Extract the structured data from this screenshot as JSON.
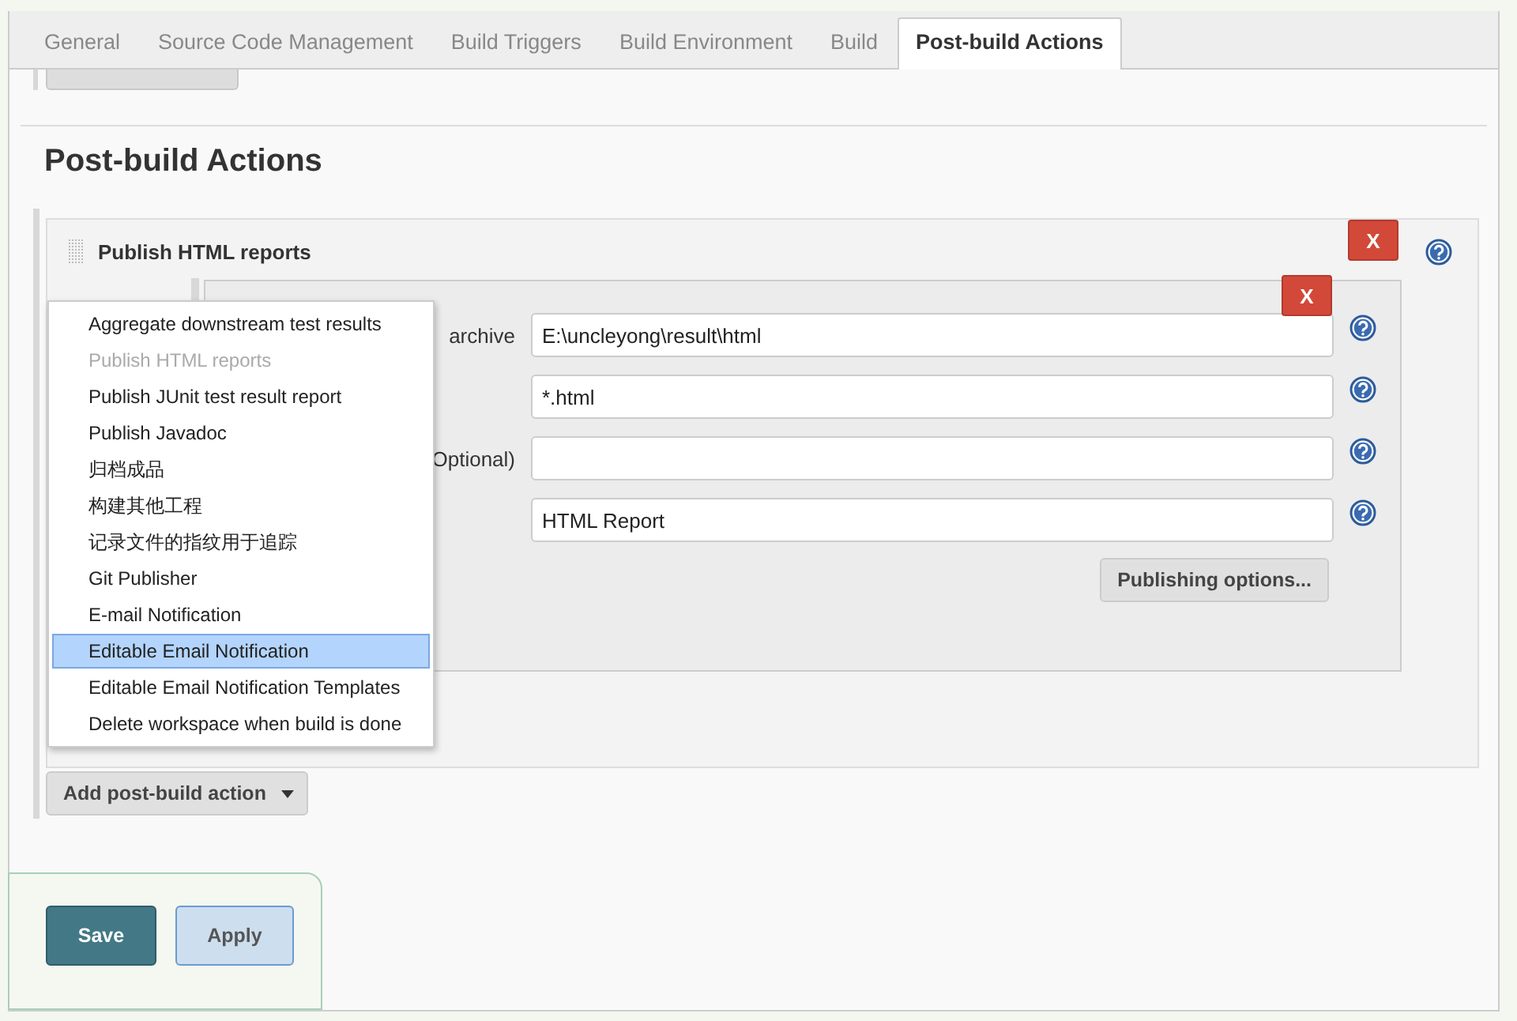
{
  "tabs": [
    {
      "label": "General",
      "selected": false
    },
    {
      "label": "Source Code Management",
      "selected": false
    },
    {
      "label": "Build Triggers",
      "selected": false
    },
    {
      "label": "Build Environment",
      "selected": false
    },
    {
      "label": "Build",
      "selected": false
    },
    {
      "label": "Post-build Actions",
      "selected": true
    }
  ],
  "section_heading": "Post-build Actions",
  "publisher": {
    "title": "Publish HTML reports",
    "delete_button": "X",
    "report": {
      "delete_button": "X",
      "fields": [
        {
          "label": "archive",
          "value": "E:\\uncleyong\\result\\html"
        },
        {
          "value": "*.html"
        },
        {
          "label": "Optional)"
        },
        {
          "value": "HTML Report"
        }
      ],
      "publishing_options_button": "Publishing options..."
    }
  },
  "add_action_button": "Add post-build action",
  "dropdown_menu": [
    {
      "label": "Aggregate downstream test results",
      "disabled": false,
      "selected": false
    },
    {
      "label": "Publish HTML reports",
      "disabled": true,
      "selected": false
    },
    {
      "label": "Publish JUnit test result report",
      "disabled": false,
      "selected": false
    },
    {
      "label": "Publish Javadoc",
      "disabled": false,
      "selected": false
    },
    {
      "label": "归档成品",
      "disabled": false,
      "selected": false
    },
    {
      "label": "构建其他工程",
      "disabled": false,
      "selected": false
    },
    {
      "label": "记录文件的指纹用于追踪",
      "disabled": false,
      "selected": false
    },
    {
      "label": "Git Publisher",
      "disabled": false,
      "selected": false
    },
    {
      "label": "E-mail Notification",
      "disabled": false,
      "selected": false
    },
    {
      "label": "Editable Email Notification",
      "disabled": false,
      "selected": true
    },
    {
      "label": "Editable Email Notification Templates",
      "disabled": false,
      "selected": false
    },
    {
      "label": "Delete workspace when build is done",
      "disabled": false,
      "selected": false
    }
  ],
  "buttons": [
    {
      "kind": "primary",
      "label": "Save"
    },
    {
      "kind": "secondary",
      "label": "Apply"
    }
  ]
}
